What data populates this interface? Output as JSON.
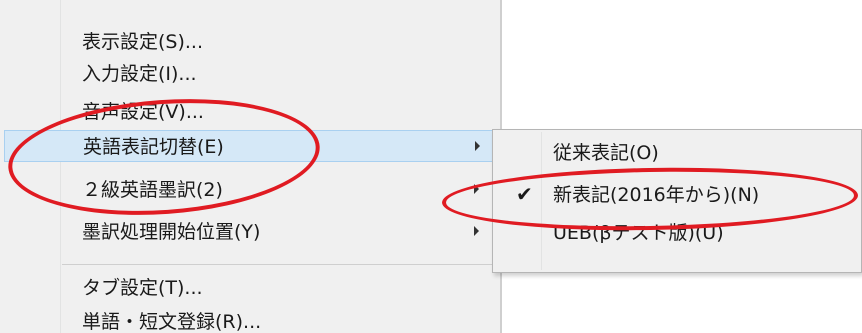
{
  "menu": {
    "items": [
      {
        "label": "表示設定(S)...",
        "submenu": false
      },
      {
        "label": "入力設定(I)...",
        "submenu": false
      },
      {
        "label": "音声設定(V)...",
        "submenu": false
      },
      {
        "label": "英語表記切替(E)",
        "submenu": true
      },
      {
        "label": "２級英語墨訳(2)",
        "submenu": true
      },
      {
        "label": "墨訳処理開始位置(Y)",
        "submenu": true
      },
      {
        "label": "タブ設定(T)...",
        "submenu": false
      },
      {
        "label": "単語・短文登録(R)...",
        "submenu": false
      }
    ],
    "highlighted_item": "英語表記切替(E)"
  },
  "submenu": {
    "items": [
      {
        "label": "従来表記(O)",
        "checked": false
      },
      {
        "label": "新表記(2016年から)(N)",
        "checked": true
      },
      {
        "label": "UEB(βテスト版)(U)",
        "checked": false
      }
    ]
  },
  "icons": {
    "check": "checkmark-icon",
    "submenu_arrow": "chevron-right-icon"
  },
  "colors": {
    "menu_background": "#f0f0f0",
    "highlight": "#d5e8f7",
    "annotation": "#e01b22"
  }
}
